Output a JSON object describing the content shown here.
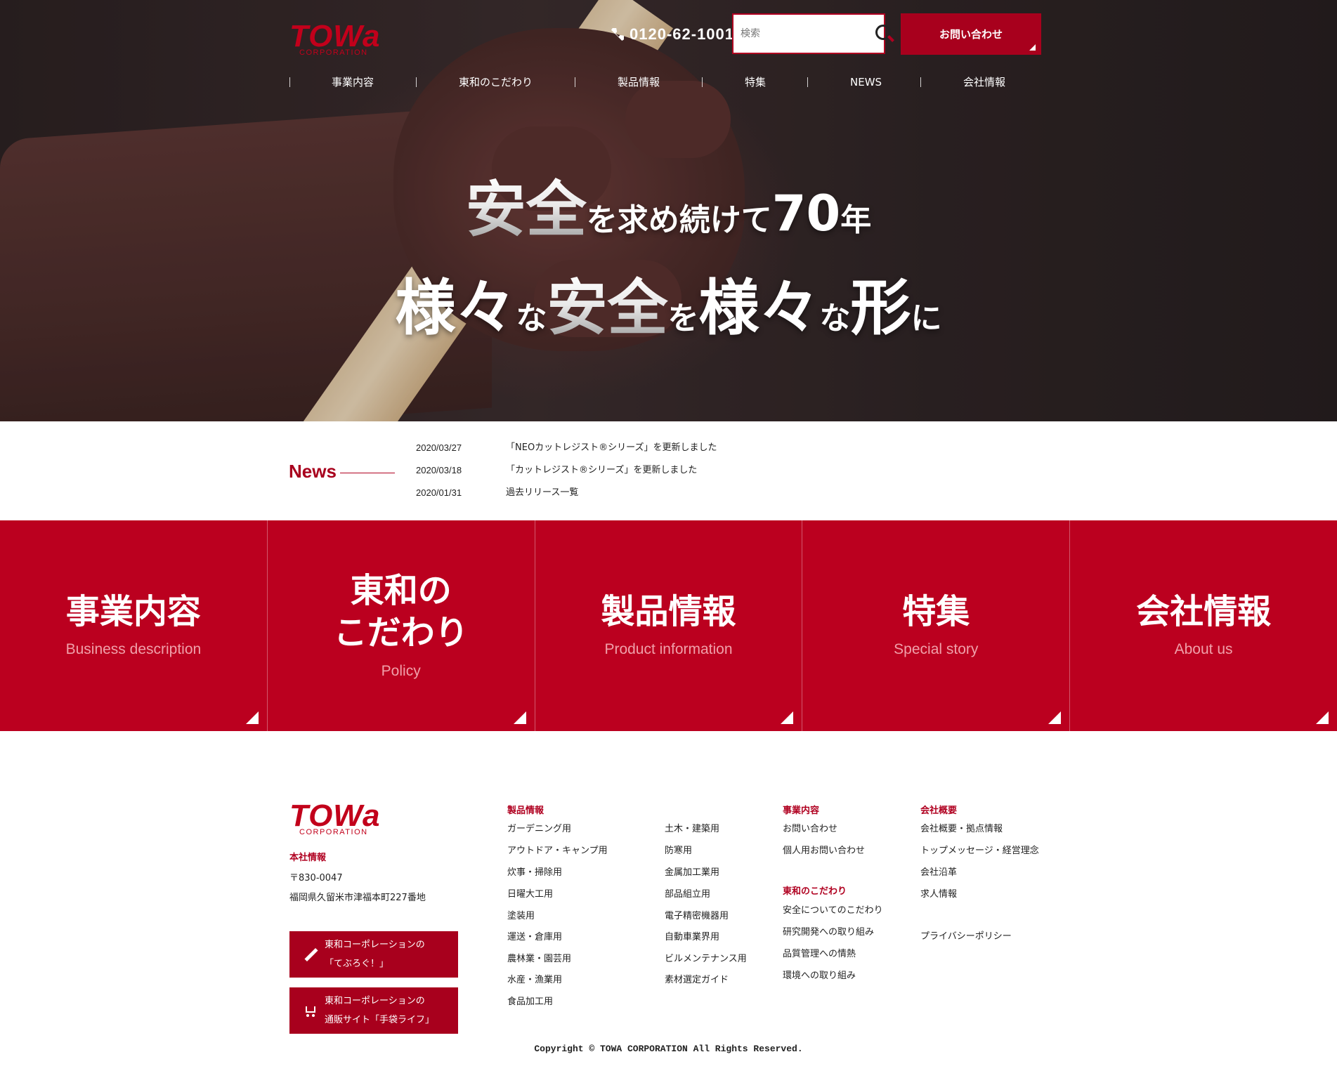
{
  "header": {
    "logo_word": "TOWa",
    "logo_sub": "CORPORATION",
    "phone": "0120-62-1001",
    "search_placeholder": "検索",
    "contact_label": "お問い合わせ"
  },
  "nav": [
    "事業内容",
    "東和のこだわり",
    "製品情報",
    "特集",
    "NEWS",
    "会社情報"
  ],
  "hero": {
    "line1": {
      "a": "安全",
      "b": "を求め続けて",
      "c": "70",
      "d": "年"
    },
    "line2": {
      "a": "様々",
      "b": "な",
      "c": "安全",
      "d": "を",
      "e": "様々",
      "f": "な",
      "g": "形",
      "h": "に"
    }
  },
  "news": {
    "title": "News",
    "items": [
      {
        "date": "2020/03/27",
        "title": "「NEOカットレジスト®シリーズ」を更新しました"
      },
      {
        "date": "2020/03/18",
        "title": "「カットレジスト®シリーズ」を更新しました"
      },
      {
        "date": "2020/01/31",
        "title": "過去リリース一覧"
      }
    ]
  },
  "tiles": [
    {
      "jp": "事業内容",
      "en": "Business description"
    },
    {
      "jp": "東和の\nこだわり",
      "en": "Policy"
    },
    {
      "jp": "製品情報",
      "en": "Product information"
    },
    {
      "jp": "特集",
      "en": "Special story"
    },
    {
      "jp": "会社情報",
      "en": "About us"
    }
  ],
  "footer": {
    "logo_word": "TOWa",
    "logo_sub": "CORPORATION",
    "hq_label": "本社情報",
    "postal": "〒830-0047",
    "address": "福岡県久留米市津福本町227番地",
    "blog_btn": {
      "line1": "東和コーポレーションの",
      "line2": "「てぶろぐ！」"
    },
    "shop_btn": {
      "line1": "東和コーポレーションの",
      "line2": "通販サイト「手袋ライフ」"
    },
    "products_label": "製品情報",
    "products_col1": [
      "ガーデニング用",
      "アウトドア・キャンプ用",
      "炊事・掃除用",
      "日曜大工用",
      "塗装用",
      "運送・倉庫用",
      "農林業・園芸用",
      "水産・漁業用",
      "食品加工用"
    ],
    "products_col2": [
      "土木・建築用",
      "防寒用",
      "金属加工業用",
      "部品組立用",
      "電子精密機器用",
      "自動車業界用",
      "ビルメンテナンス用",
      "素材選定ガイド"
    ],
    "business_label": "事業内容",
    "business_links": [
      "お問い合わせ",
      "個人用お問い合わせ"
    ],
    "policy_label": "東和のこだわり",
    "policy_links": [
      "安全についてのこだわり",
      "研究開発への取り組み",
      "品質管理への情熱",
      "環境への取り組み"
    ],
    "company_label": "会社概要",
    "company_links": [
      "会社概要・拠点情報",
      "トップメッセージ・経営理念",
      "会社沿革",
      "求人情報"
    ],
    "privacy": "プライバシーポリシー",
    "copyright": "Copyright © TOWA CORPORATION All Rights Reserved."
  },
  "colors": {
    "brand_red": "#bb001f",
    "dark_red": "#a8001d",
    "hero_bg": "#2d2324"
  }
}
